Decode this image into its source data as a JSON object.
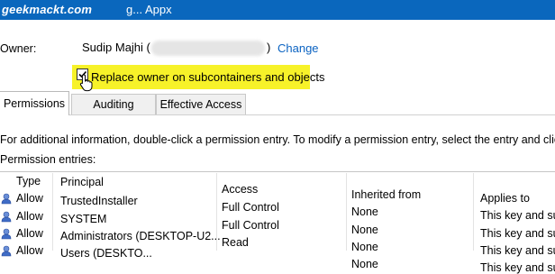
{
  "window": {
    "watermark": "geekmackt.com",
    "title_fragment": "g... Appx"
  },
  "owner": {
    "label": "Owner:",
    "name": "Sudip Majhi (",
    "paren_close": ")",
    "change_link": "Change"
  },
  "replace_owner": {
    "label": "Replace owner on subcontainers and objects",
    "checked": true
  },
  "tabs": [
    {
      "label": "Permissions",
      "active": true
    },
    {
      "label": "Auditing",
      "active": false
    },
    {
      "label": "Effective Access",
      "active": false
    }
  ],
  "info_text": "For additional information, double-click a permission entry. To modify a permission entry, select the entry and click Ed",
  "entries_label": "Permission entries:",
  "table": {
    "headers": [
      "Type",
      "Principal",
      "Access",
      "Inherited from",
      "Applies to"
    ],
    "rows": [
      {
        "type": "Allow",
        "principal": "TrustedInstaller",
        "access": "Full Control",
        "inherited": "None",
        "applies": "This key and subke"
      },
      {
        "type": "Allow",
        "principal": "SYSTEM",
        "access": "Full Control",
        "inherited": "None",
        "applies": "This key and subke"
      },
      {
        "type": "Allow",
        "principal": "Administrators (DESKTOP-U2...",
        "access": "Read",
        "inherited": "None",
        "applies": "This key and subke"
      },
      {
        "type": "Allow",
        "principal": "Users (DESKTO...",
        "access": "",
        "inherited": "None",
        "applies": "This key and subke"
      }
    ]
  },
  "colors": {
    "title_bar": "#0a67bd",
    "highlight": "#f7f229",
    "link": "#0b63c2"
  }
}
